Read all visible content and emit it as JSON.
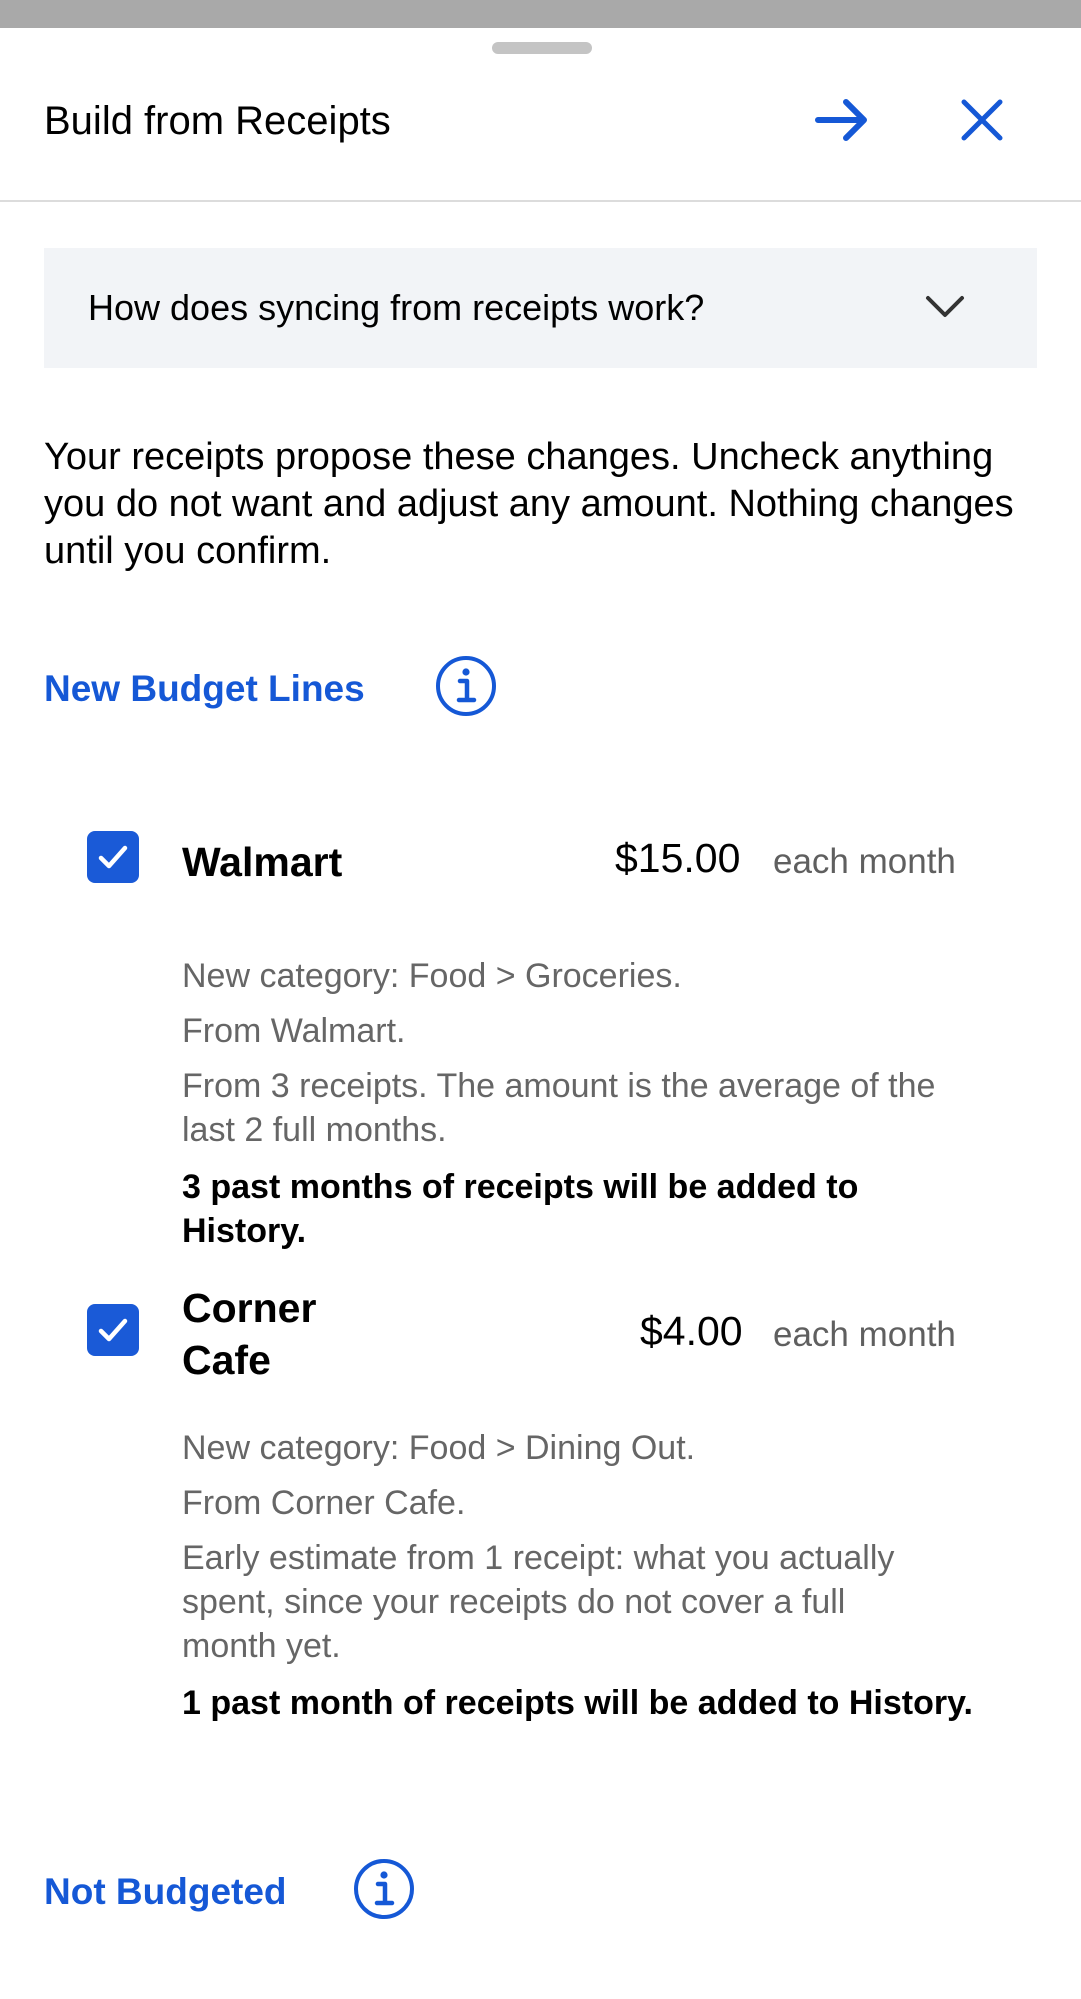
{
  "header": {
    "title": "Build from Receipts"
  },
  "faq": {
    "question": "How does syncing from receipts work?"
  },
  "intro": "Your receipts propose these changes. Uncheck anything you do not want and adjust any amount. Nothing changes until you confirm.",
  "sections": {
    "new_budget_lines": {
      "title": "New Budget Lines"
    },
    "not_budgeted": {
      "title": "Not Budgeted"
    }
  },
  "items": [
    {
      "checked": true,
      "name": "Walmart",
      "amount": "$15.00",
      "period": "each month",
      "category": "New category: Food > Groceries.",
      "source": "From Walmart.",
      "note": "From 3 receipts. The amount is the average of the last 2 full months.",
      "history": "3 past months of receipts will be added to History."
    },
    {
      "checked": true,
      "name": "Corner Cafe",
      "amount": "$4.00",
      "period": "each month",
      "category": "New category: Food > Dining Out.",
      "source": "From Corner Cafe.",
      "note": "Early estimate from 1 receipt: what you actually spent, since your receipts do not cover a full month yet.",
      "history": "1 past month of receipts will be added to History."
    }
  ],
  "icons": {
    "next": "arrow-right-icon",
    "close": "close-icon",
    "expand": "chevron-down-icon",
    "info": "info-icon",
    "check": "checkmark-icon"
  },
  "colors": {
    "accent": "#1558d6",
    "checkbox": "#1a5ad7",
    "faq_bg": "#f2f4f7",
    "muted_text": "#666666"
  }
}
